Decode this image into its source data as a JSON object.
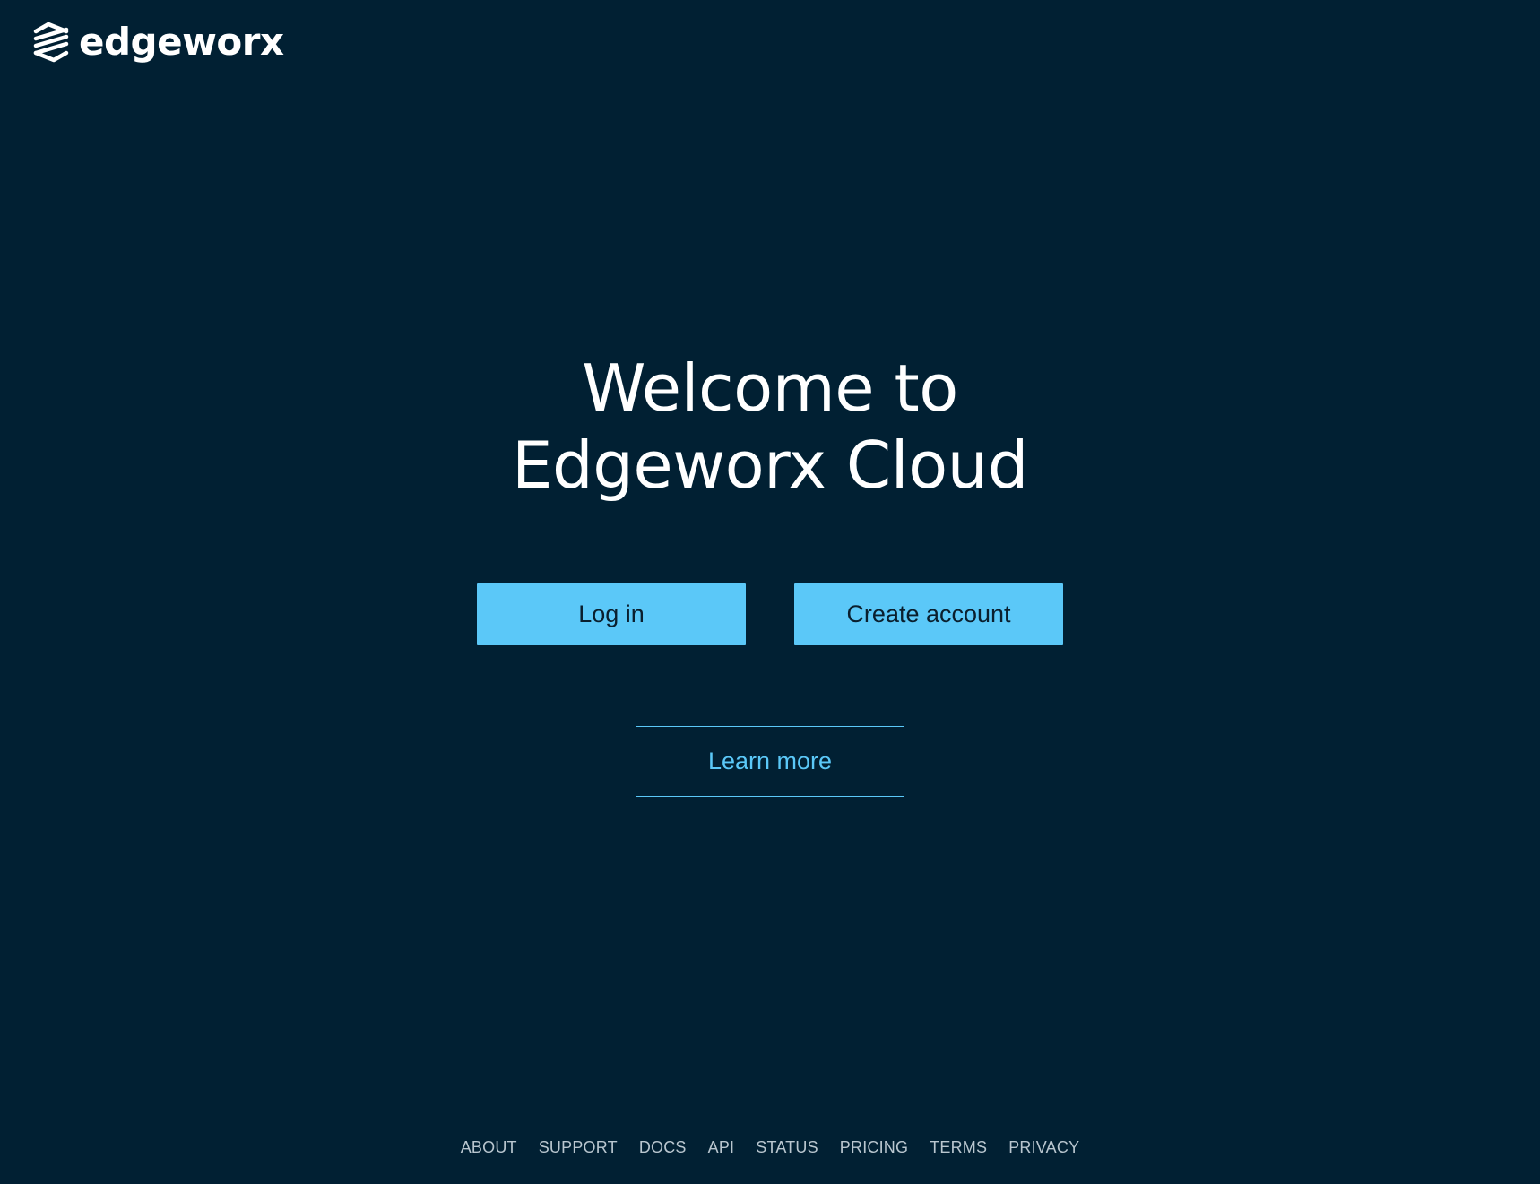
{
  "brand": {
    "name": "edgeworx",
    "logo_icon": "edgeworx-logo-icon"
  },
  "hero": {
    "title_line1": "Welcome to",
    "title_line2": "Edgeworx Cloud"
  },
  "actions": {
    "login_label": "Log in",
    "create_account_label": "Create account",
    "learn_more_label": "Learn more"
  },
  "footer": {
    "links": [
      "ABOUT",
      "SUPPORT",
      "DOCS",
      "API",
      "STATUS",
      "PRICING",
      "TERMS",
      "PRIVACY"
    ]
  },
  "colors": {
    "background": "#012033",
    "accent": "#5bc8f8",
    "text": "#ffffff",
    "footer_text": "#b9c6cf"
  }
}
